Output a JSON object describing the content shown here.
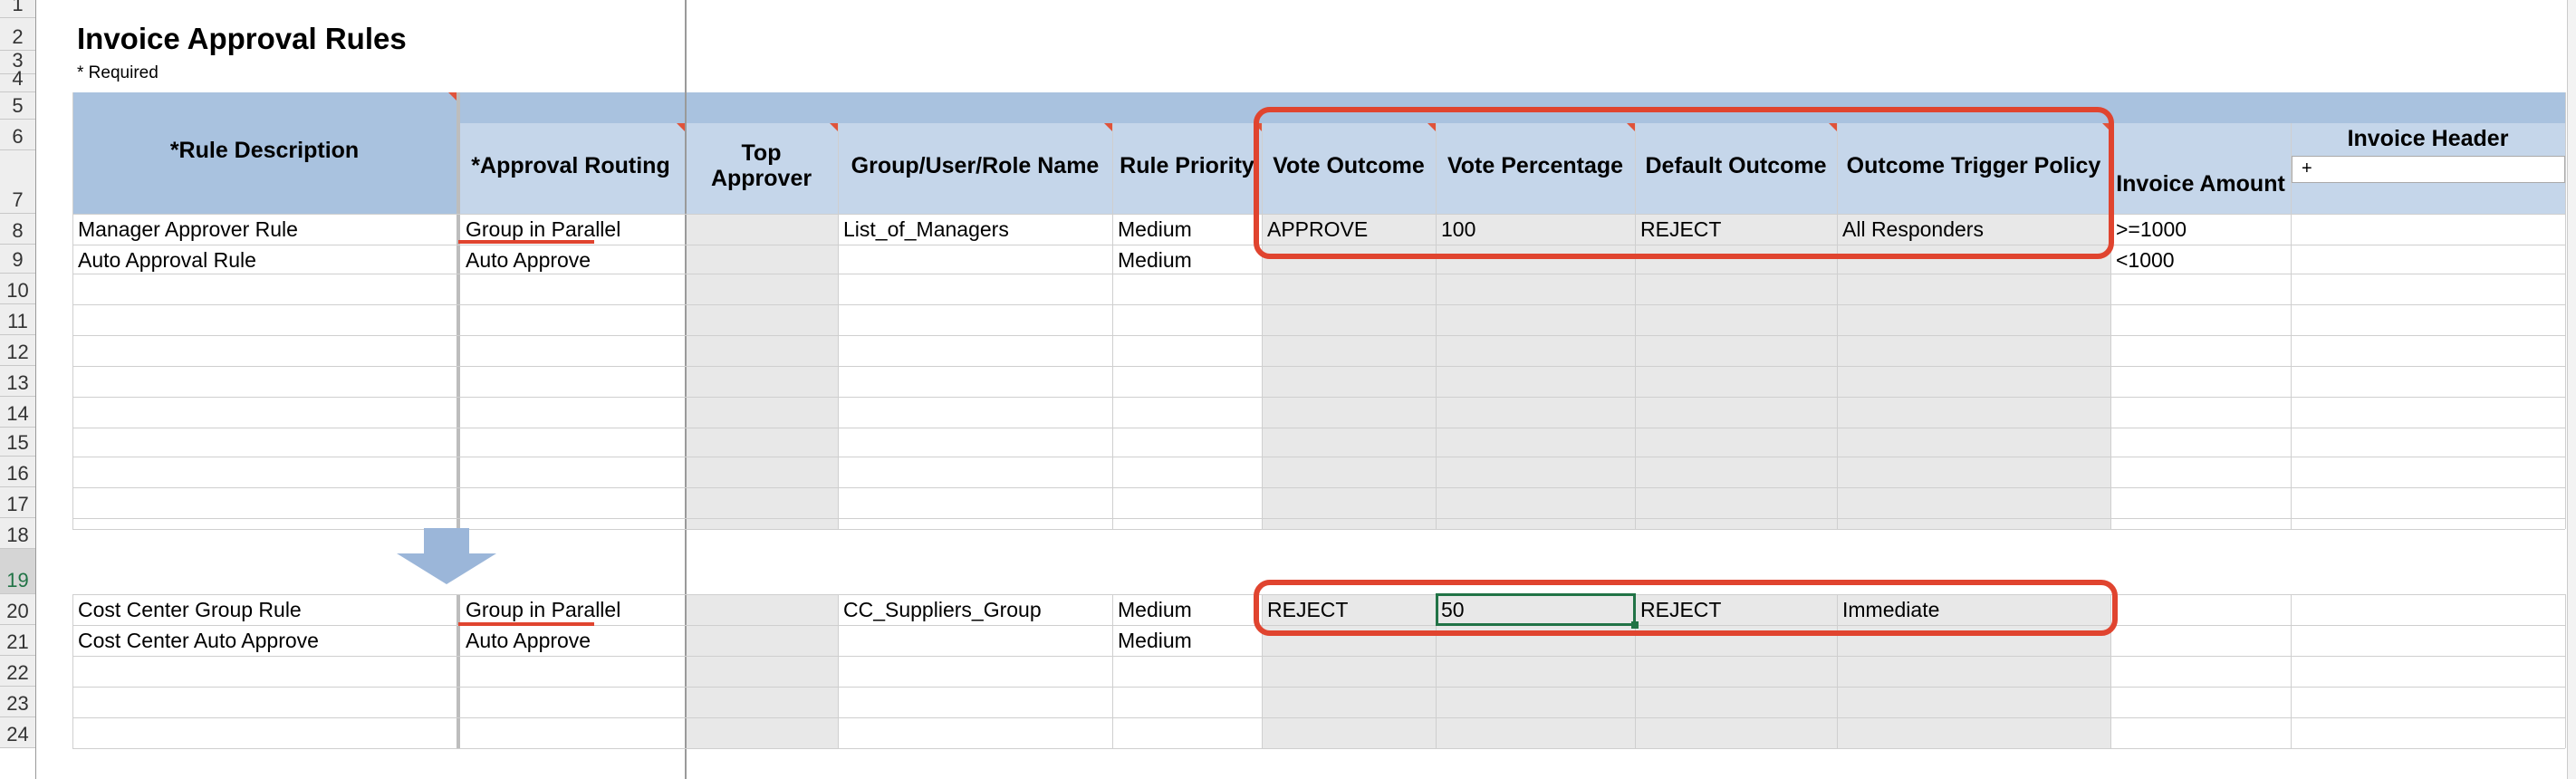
{
  "sheet": {
    "title": "Invoice Approval Rules",
    "required_note": "* Required",
    "row_numbers": [
      "1",
      "2",
      "3",
      "4",
      "5",
      "6",
      "7",
      "8",
      "9",
      "10",
      "11",
      "12",
      "13",
      "14",
      "15",
      "16",
      "17",
      "18",
      "19",
      "20",
      "21",
      "22",
      "23",
      "24"
    ],
    "group_header": "Invoice Header",
    "filter_value": "+",
    "headers": {
      "rule_description": "*Rule Description",
      "approval_routing": "*Approval Routing",
      "top_approver": "Top Approver",
      "group_user_role": "Group/User/Role Name",
      "rule_priority": "Rule Priority",
      "vote_outcome": "Vote Outcome",
      "vote_percentage": "Vote Percentage",
      "default_outcome": "Default Outcome",
      "outcome_trigger_policy": "Outcome Trigger Policy",
      "invoice_amount": "Invoice Amount"
    },
    "rows_top": [
      {
        "desc": "Manager Approver Rule",
        "routing": "Group in Parallel",
        "top": "",
        "group": "List_of_Managers",
        "priority": "Medium",
        "vote": "APPROVE",
        "pct": "100",
        "default": "REJECT",
        "policy": "All Responders",
        "amount": ">=1000"
      },
      {
        "desc": "Auto Approval Rule",
        "routing": "Auto Approve",
        "top": "",
        "group": "",
        "priority": "Medium",
        "vote": "",
        "pct": "",
        "default": "",
        "policy": "",
        "amount": "<1000"
      }
    ],
    "rows_bottom": [
      {
        "desc": "Cost Center Group Rule",
        "routing": "Group in Parallel",
        "top": "",
        "group": "CC_Suppliers_Group",
        "priority": "Medium",
        "vote": "REJECT",
        "pct": "50",
        "default": "REJECT",
        "policy": "Immediate",
        "amount": ""
      },
      {
        "desc": "Cost Center Auto Approve",
        "routing": "Auto Approve",
        "top": "",
        "group": "",
        "priority": "Medium",
        "vote": "",
        "pct": "",
        "default": "",
        "policy": "",
        "amount": ""
      }
    ]
  },
  "colors": {
    "header_blue": "#c5d6ea",
    "header_dark_blue": "#a9c2df",
    "grey_fill": "#e8e8e8",
    "annotation_red": "#e0442f",
    "arrow_blue": "#9bb6d9",
    "selected_green": "#217346"
  }
}
